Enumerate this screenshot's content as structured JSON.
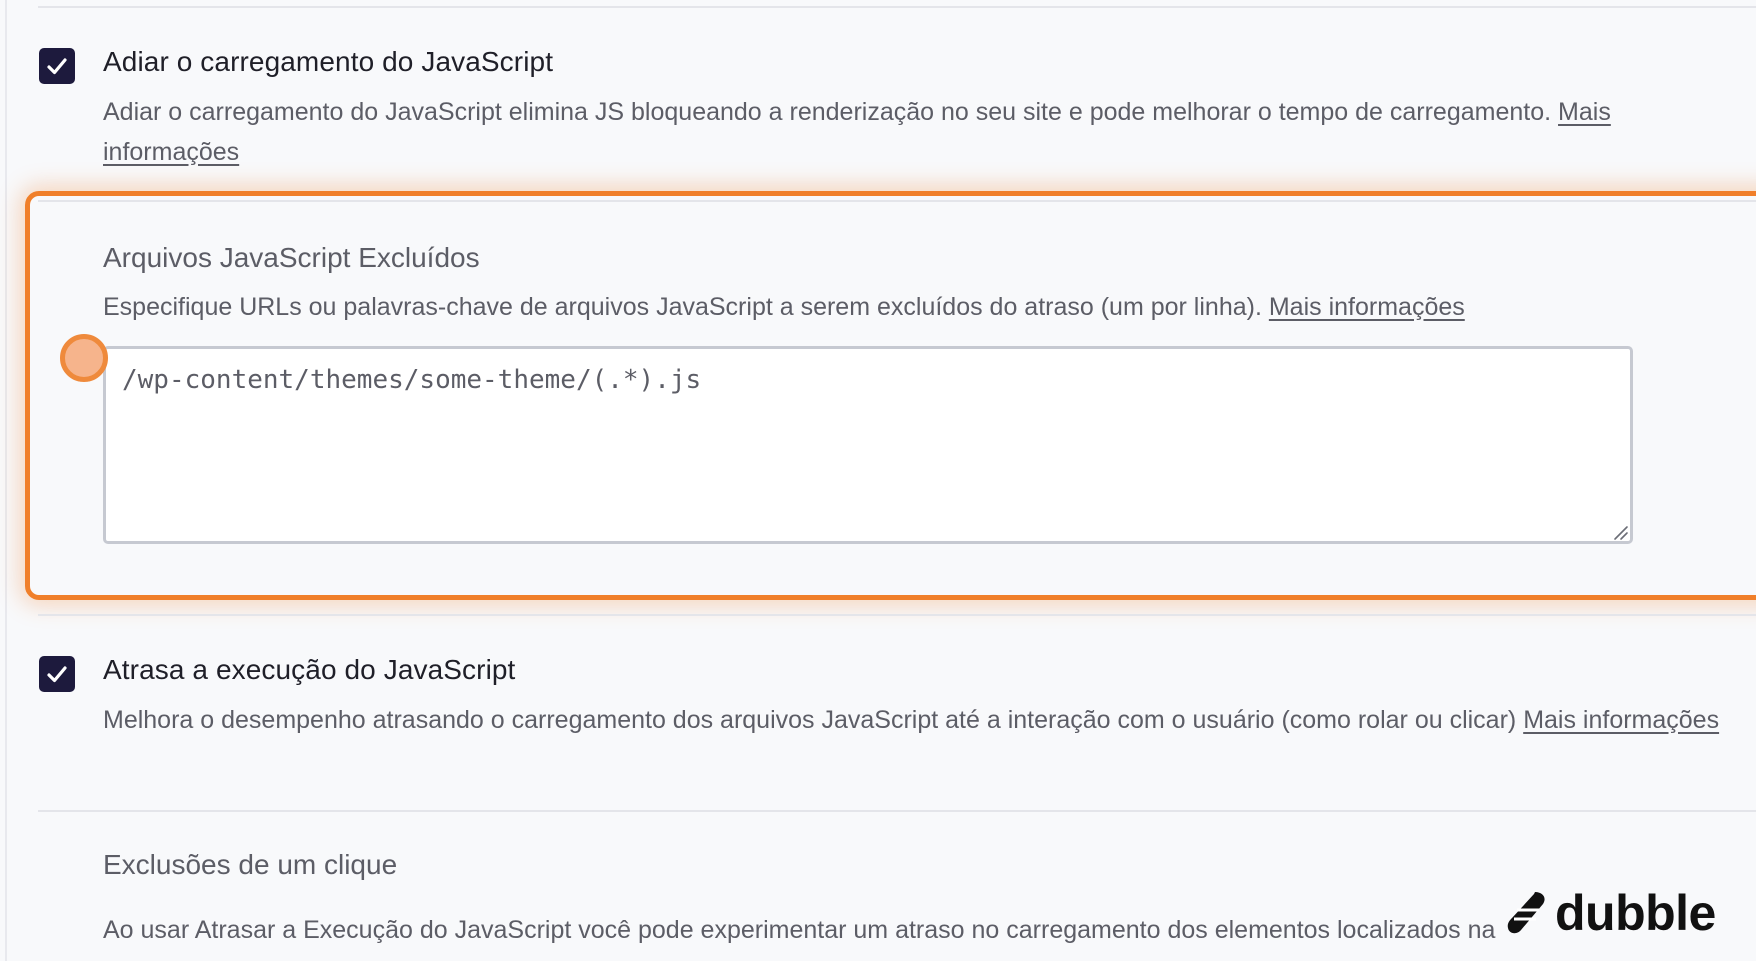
{
  "options": {
    "defer_js": {
      "checked": true,
      "title": "Adiar o carregamento do JavaScript",
      "description": "Adiar o carregamento do JavaScript elimina JS bloqueando a renderização no seu site e pode melhorar o tempo de carregamento. ",
      "link": "Mais informações"
    },
    "excluded_files": {
      "title": "Arquivos JavaScript Excluídos",
      "description": "Especifique URLs ou palavras-chave de arquivos JavaScript a serem excluídos do atraso (um por linha). ",
      "link": "Mais informações",
      "textarea_value": "/wp-content/themes/some-theme/(.*).js"
    },
    "delay_js": {
      "checked": true,
      "title": "Atrasa a execução do JavaScript",
      "description": "Melhora o desempenho atrasando o carregamento dos arquivos JavaScript até a interação com o usuário (como rolar ou clicar) ",
      "link": "Mais informações"
    },
    "one_click": {
      "title": "Exclusões de um clique",
      "description": "Ao usar Atrasar a Execução do JavaScript você pode experimentar um atraso no carregamento dos elementos localizados na"
    }
  },
  "watermark": {
    "text": "dubble",
    "icon": "dubble-logo-icon"
  },
  "colors": {
    "checkbox": "#1d1a3d",
    "highlight": "#f07f2a",
    "cursor": "#f6b48c"
  }
}
